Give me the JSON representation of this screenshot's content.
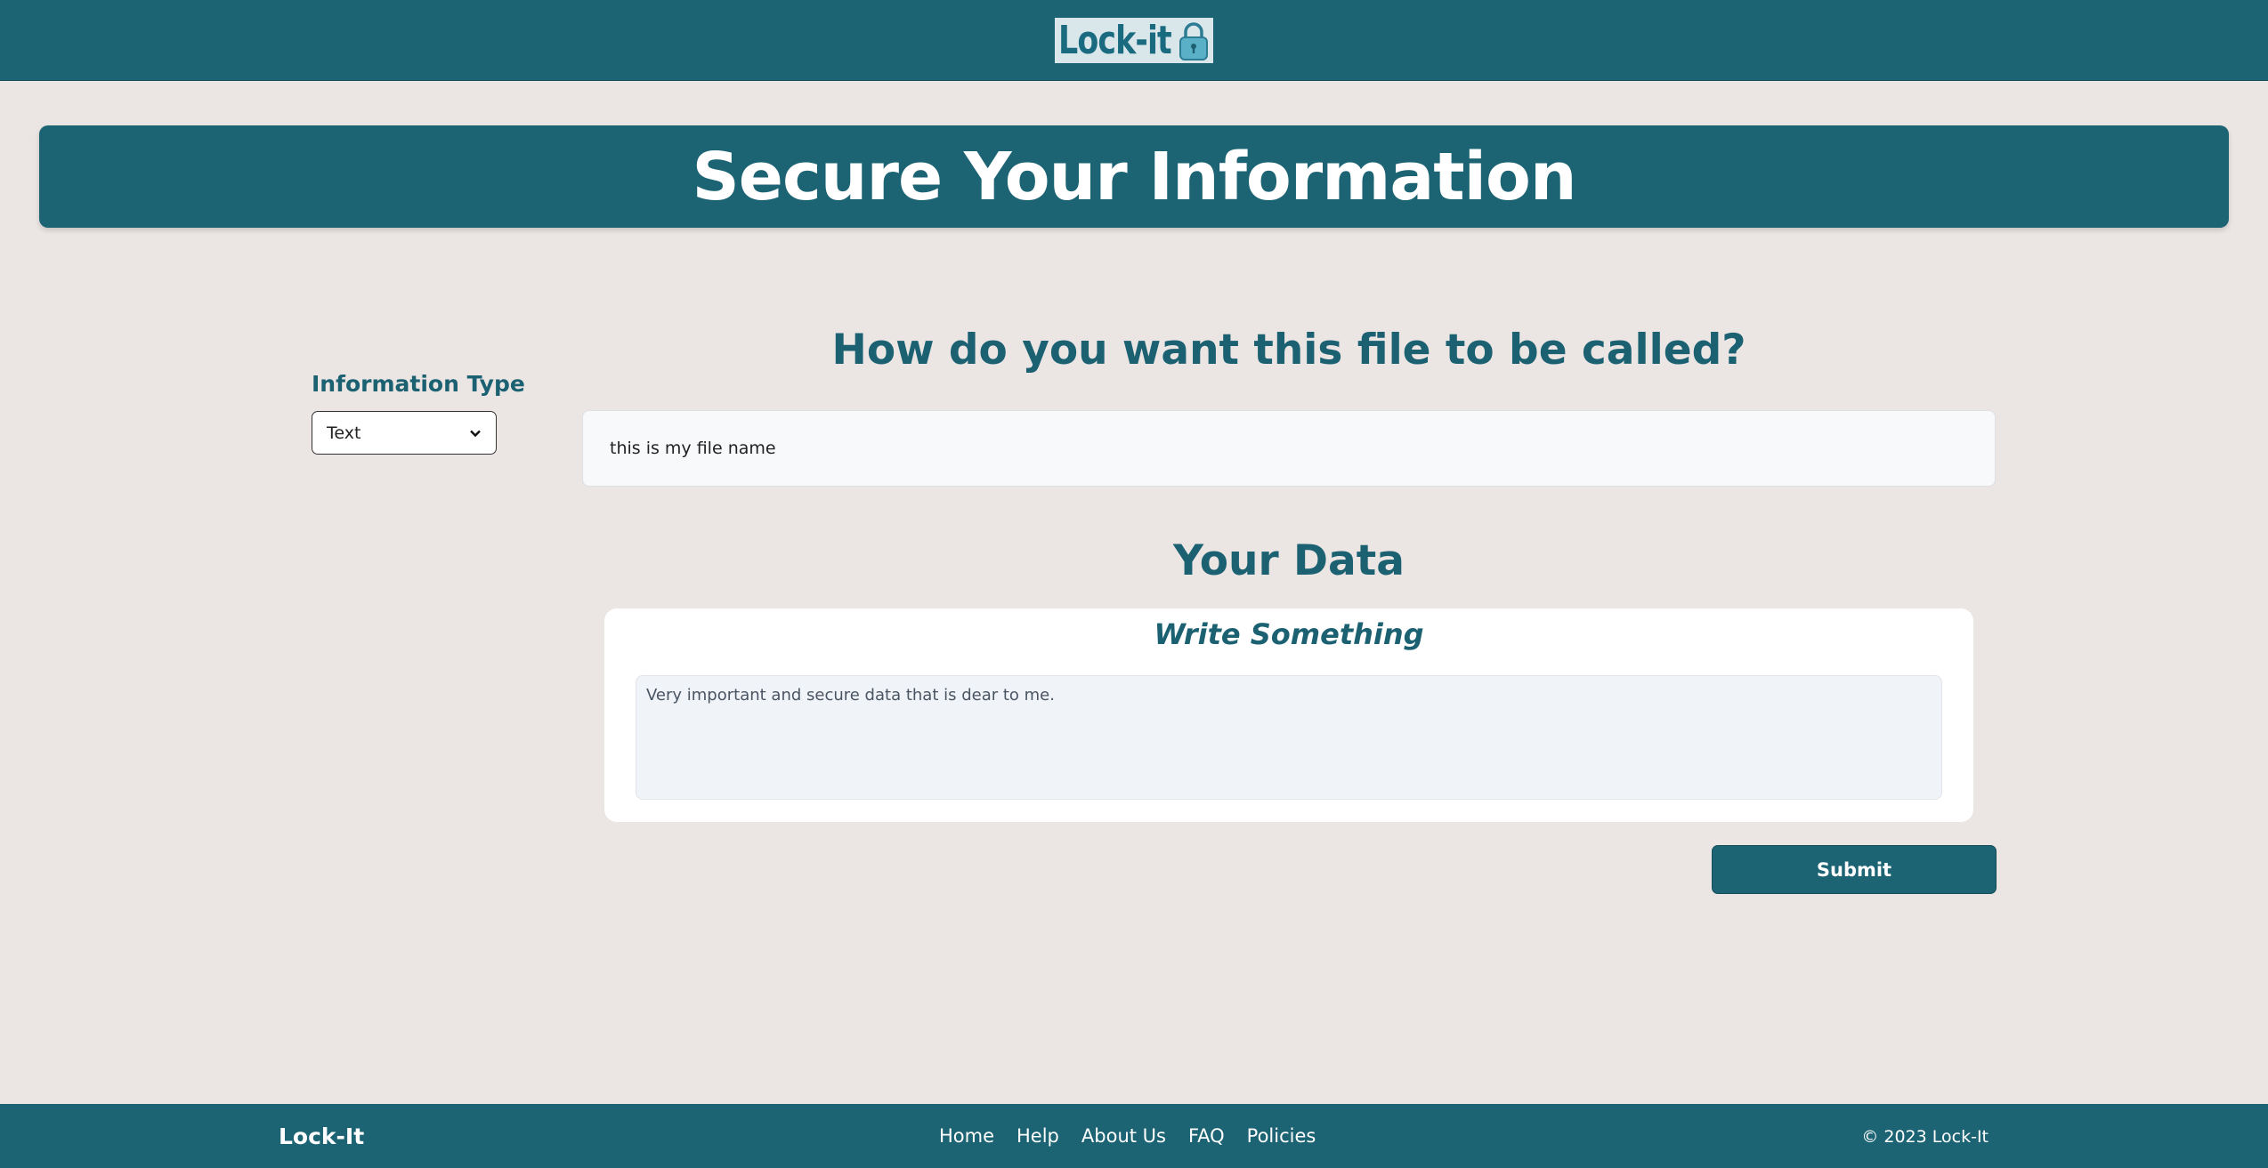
{
  "header": {
    "logo_text": "Lock-it",
    "logo_icon": "padlock-icon"
  },
  "banner": {
    "title": "Secure Your Information"
  },
  "sidebar": {
    "label": "Information Type",
    "select_value": "Text"
  },
  "form": {
    "file_name_question": "How do you want this file to be called?",
    "file_name_value": "this is my file name",
    "data_title": "Your Data",
    "card_title": "Write Something",
    "data_value": "Very important and secure data that is dear to me.",
    "submit_label": "Submit"
  },
  "footer": {
    "brand": "Lock-It",
    "links": [
      "Home",
      "Help",
      "About Us",
      "FAQ",
      "Policies"
    ],
    "copyright": "© 2023 Lock-It"
  },
  "colors": {
    "primary": "#1c6373",
    "background": "#ebe5e4",
    "heading": "#1b6171"
  }
}
